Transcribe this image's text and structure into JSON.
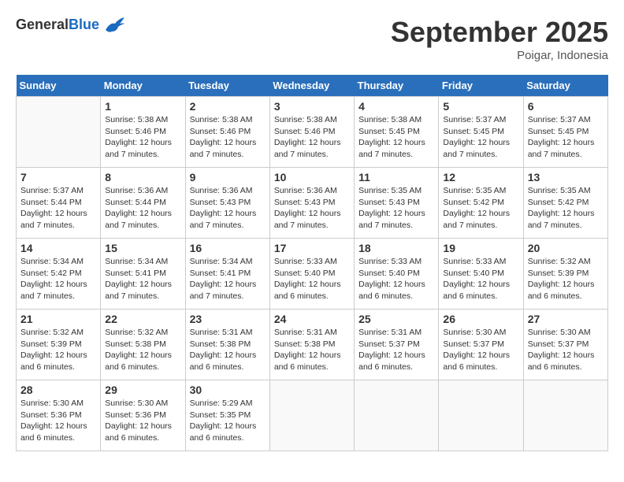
{
  "header": {
    "logo_general": "General",
    "logo_blue": "Blue",
    "month": "September 2025",
    "location": "Poigar, Indonesia"
  },
  "days_of_week": [
    "Sunday",
    "Monday",
    "Tuesday",
    "Wednesday",
    "Thursday",
    "Friday",
    "Saturday"
  ],
  "weeks": [
    [
      {
        "day": "",
        "text": ""
      },
      {
        "day": "1",
        "text": "Sunrise: 5:38 AM\nSunset: 5:46 PM\nDaylight: 12 hours\nand 7 minutes."
      },
      {
        "day": "2",
        "text": "Sunrise: 5:38 AM\nSunset: 5:46 PM\nDaylight: 12 hours\nand 7 minutes."
      },
      {
        "day": "3",
        "text": "Sunrise: 5:38 AM\nSunset: 5:46 PM\nDaylight: 12 hours\nand 7 minutes."
      },
      {
        "day": "4",
        "text": "Sunrise: 5:38 AM\nSunset: 5:45 PM\nDaylight: 12 hours\nand 7 minutes."
      },
      {
        "day": "5",
        "text": "Sunrise: 5:37 AM\nSunset: 5:45 PM\nDaylight: 12 hours\nand 7 minutes."
      },
      {
        "day": "6",
        "text": "Sunrise: 5:37 AM\nSunset: 5:45 PM\nDaylight: 12 hours\nand 7 minutes."
      }
    ],
    [
      {
        "day": "7",
        "text": "Sunrise: 5:37 AM\nSunset: 5:44 PM\nDaylight: 12 hours\nand 7 minutes."
      },
      {
        "day": "8",
        "text": "Sunrise: 5:36 AM\nSunset: 5:44 PM\nDaylight: 12 hours\nand 7 minutes."
      },
      {
        "day": "9",
        "text": "Sunrise: 5:36 AM\nSunset: 5:43 PM\nDaylight: 12 hours\nand 7 minutes."
      },
      {
        "day": "10",
        "text": "Sunrise: 5:36 AM\nSunset: 5:43 PM\nDaylight: 12 hours\nand 7 minutes."
      },
      {
        "day": "11",
        "text": "Sunrise: 5:35 AM\nSunset: 5:43 PM\nDaylight: 12 hours\nand 7 minutes."
      },
      {
        "day": "12",
        "text": "Sunrise: 5:35 AM\nSunset: 5:42 PM\nDaylight: 12 hours\nand 7 minutes."
      },
      {
        "day": "13",
        "text": "Sunrise: 5:35 AM\nSunset: 5:42 PM\nDaylight: 12 hours\nand 7 minutes."
      }
    ],
    [
      {
        "day": "14",
        "text": "Sunrise: 5:34 AM\nSunset: 5:42 PM\nDaylight: 12 hours\nand 7 minutes."
      },
      {
        "day": "15",
        "text": "Sunrise: 5:34 AM\nSunset: 5:41 PM\nDaylight: 12 hours\nand 7 minutes."
      },
      {
        "day": "16",
        "text": "Sunrise: 5:34 AM\nSunset: 5:41 PM\nDaylight: 12 hours\nand 7 minutes."
      },
      {
        "day": "17",
        "text": "Sunrise: 5:33 AM\nSunset: 5:40 PM\nDaylight: 12 hours\nand 6 minutes."
      },
      {
        "day": "18",
        "text": "Sunrise: 5:33 AM\nSunset: 5:40 PM\nDaylight: 12 hours\nand 6 minutes."
      },
      {
        "day": "19",
        "text": "Sunrise: 5:33 AM\nSunset: 5:40 PM\nDaylight: 12 hours\nand 6 minutes."
      },
      {
        "day": "20",
        "text": "Sunrise: 5:32 AM\nSunset: 5:39 PM\nDaylight: 12 hours\nand 6 minutes."
      }
    ],
    [
      {
        "day": "21",
        "text": "Sunrise: 5:32 AM\nSunset: 5:39 PM\nDaylight: 12 hours\nand 6 minutes."
      },
      {
        "day": "22",
        "text": "Sunrise: 5:32 AM\nSunset: 5:38 PM\nDaylight: 12 hours\nand 6 minutes."
      },
      {
        "day": "23",
        "text": "Sunrise: 5:31 AM\nSunset: 5:38 PM\nDaylight: 12 hours\nand 6 minutes."
      },
      {
        "day": "24",
        "text": "Sunrise: 5:31 AM\nSunset: 5:38 PM\nDaylight: 12 hours\nand 6 minutes."
      },
      {
        "day": "25",
        "text": "Sunrise: 5:31 AM\nSunset: 5:37 PM\nDaylight: 12 hours\nand 6 minutes."
      },
      {
        "day": "26",
        "text": "Sunrise: 5:30 AM\nSunset: 5:37 PM\nDaylight: 12 hours\nand 6 minutes."
      },
      {
        "day": "27",
        "text": "Sunrise: 5:30 AM\nSunset: 5:37 PM\nDaylight: 12 hours\nand 6 minutes."
      }
    ],
    [
      {
        "day": "28",
        "text": "Sunrise: 5:30 AM\nSunset: 5:36 PM\nDaylight: 12 hours\nand 6 minutes."
      },
      {
        "day": "29",
        "text": "Sunrise: 5:30 AM\nSunset: 5:36 PM\nDaylight: 12 hours\nand 6 minutes."
      },
      {
        "day": "30",
        "text": "Sunrise: 5:29 AM\nSunset: 5:35 PM\nDaylight: 12 hours\nand 6 minutes."
      },
      {
        "day": "",
        "text": ""
      },
      {
        "day": "",
        "text": ""
      },
      {
        "day": "",
        "text": ""
      },
      {
        "day": "",
        "text": ""
      }
    ]
  ]
}
